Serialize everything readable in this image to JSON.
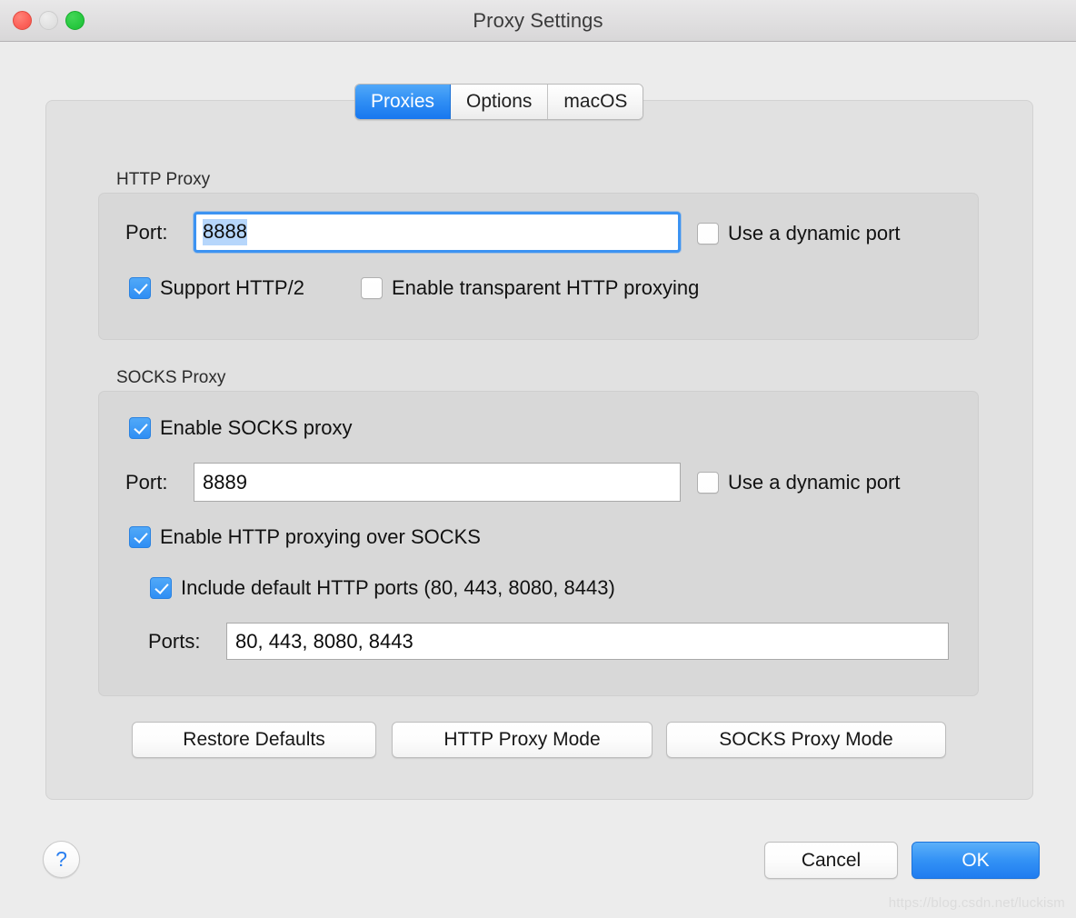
{
  "window": {
    "title": "Proxy Settings",
    "traffic_lights": {
      "close": "close-button",
      "minimize": "minimize-button",
      "zoom": "zoom-button"
    }
  },
  "tabs": [
    {
      "label": "Proxies",
      "active": true
    },
    {
      "label": "Options",
      "active": false
    },
    {
      "label": "macOS",
      "active": false
    }
  ],
  "http_proxy": {
    "group_label": "HTTP Proxy",
    "port_label": "Port:",
    "port_value": "8888",
    "port_selected": true,
    "dynamic_port": {
      "label": "Use a dynamic port",
      "checked": false
    },
    "support_http2": {
      "label": "Support HTTP/2",
      "checked": true
    },
    "transparent_proxying": {
      "label": "Enable transparent HTTP proxying",
      "checked": false
    }
  },
  "socks_proxy": {
    "group_label": "SOCKS Proxy",
    "enable_socks": {
      "label": "Enable SOCKS proxy",
      "checked": true
    },
    "port_label": "Port:",
    "port_value": "8889",
    "dynamic_port": {
      "label": "Use a dynamic port",
      "checked": false
    },
    "http_over_socks": {
      "label": "Enable HTTP proxying over SOCKS",
      "checked": true
    },
    "include_defaults": {
      "label": "Include default HTTP ports (80, 443, 8080, 8443)",
      "checked": true
    },
    "ports_label": "Ports:",
    "ports_value": "80, 443, 8080, 8443"
  },
  "mode_buttons": [
    {
      "label": "Restore Defaults"
    },
    {
      "label": "HTTP Proxy Mode"
    },
    {
      "label": "SOCKS Proxy Mode"
    }
  ],
  "footer": {
    "help_label": "?",
    "cancel_label": "Cancel",
    "ok_label": "OK"
  },
  "watermark": "https://blog.csdn.net/luckism",
  "colors": {
    "accent_blue": "#2f8ef4",
    "window_bg": "#ececec",
    "panel_bg": "#e1e1e1",
    "group_bg": "#d8d8d8",
    "selection_blue": "#b6d6fb",
    "help_blue": "#2a7ff0"
  }
}
